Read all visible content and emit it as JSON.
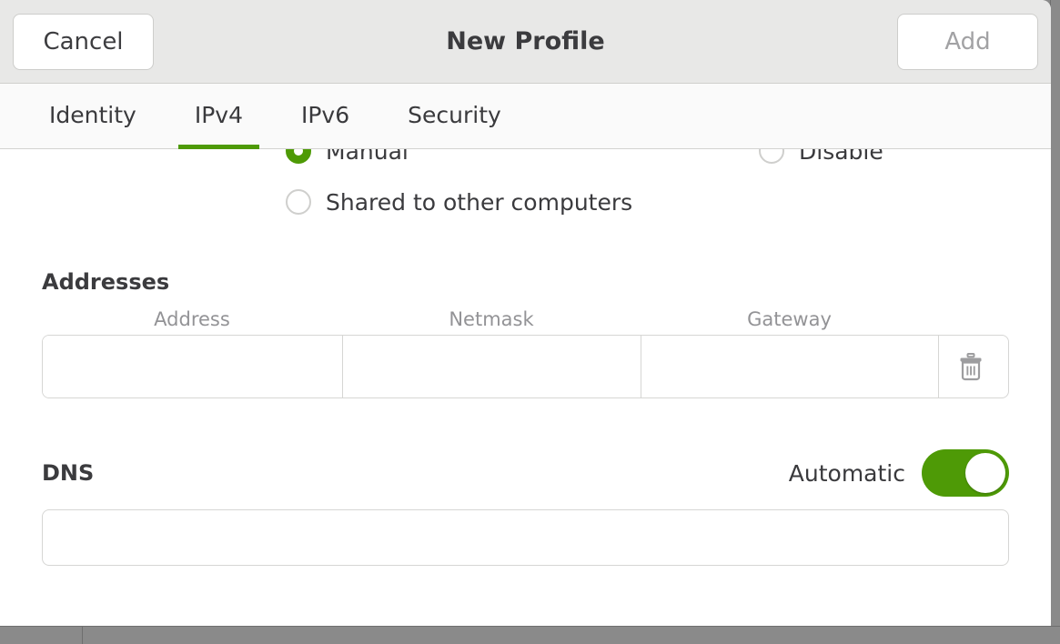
{
  "window": {
    "title": "New Profile",
    "cancel_label": "Cancel",
    "add_label": "Add"
  },
  "tabs": [
    {
      "label": "Identity",
      "active": false
    },
    {
      "label": "IPv4",
      "active": true
    },
    {
      "label": "IPv6",
      "active": false
    },
    {
      "label": "Security",
      "active": false
    }
  ],
  "ipv4": {
    "method_options": [
      {
        "label": "Manual",
        "selected": true
      },
      {
        "label": "Disable",
        "selected": false
      },
      {
        "label": "Shared to other computers",
        "selected": false
      }
    ],
    "addresses": {
      "section_title": "Addresses",
      "columns": [
        "Address",
        "Netmask",
        "Gateway"
      ],
      "rows": [
        {
          "address": "",
          "netmask": "",
          "gateway": "",
          "delete_icon": "trash-icon"
        }
      ]
    },
    "dns": {
      "section_title": "DNS",
      "automatic_label": "Automatic",
      "automatic_on": true,
      "value": "",
      "placeholder": ""
    }
  },
  "colors": {
    "accent_green": "#4e9a06",
    "header_bg": "#e8e8e7",
    "tabbar_bg": "#fafafa",
    "text": "#3a3a3d",
    "muted_text": "#939396",
    "border": "#d6d6d4",
    "desktop_bg": "#8a8a8a"
  }
}
